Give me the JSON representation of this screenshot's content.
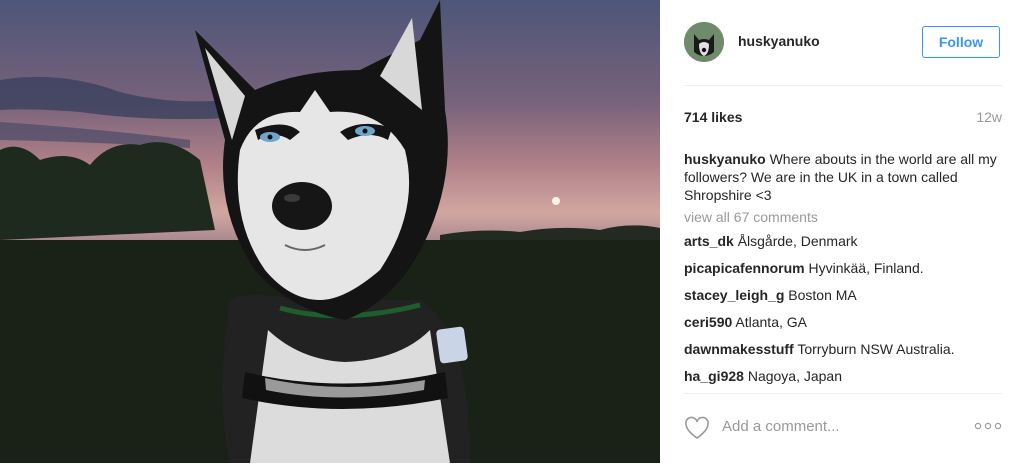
{
  "photo": {
    "alt": ""
  },
  "header": {
    "username": "huskyanuko",
    "follow_label": "Follow"
  },
  "meta": {
    "likes": "714 likes",
    "age": "12w"
  },
  "caption": {
    "username": "huskyanuko",
    "text": " Where abouts in the world are all my followers? We are in the UK in a town called Shropshire <3"
  },
  "view_all": "view all 67 comments",
  "comments": [
    {
      "user": "arts_dk",
      "text": " Ålsgårde, Denmark"
    },
    {
      "user": "picapicafennorum",
      "text": " Hyvinkää, Finland."
    },
    {
      "user": "stacey_leigh_g",
      "text": " Boston MA"
    },
    {
      "user": "ceri590",
      "text": " Atlanta, GA"
    },
    {
      "user": "dawnmakesstuff",
      "text": " Torryburn NSW Australia."
    },
    {
      "user": "ha_gi928",
      "text": " Nagoya, Japan"
    }
  ],
  "actions": {
    "comment_placeholder": "Add a comment..."
  },
  "icons": {
    "like": "heart-icon",
    "more": "more-options-icon"
  },
  "colors": {
    "accent": "#3897f0",
    "muted": "#999999",
    "text": "#262626"
  }
}
